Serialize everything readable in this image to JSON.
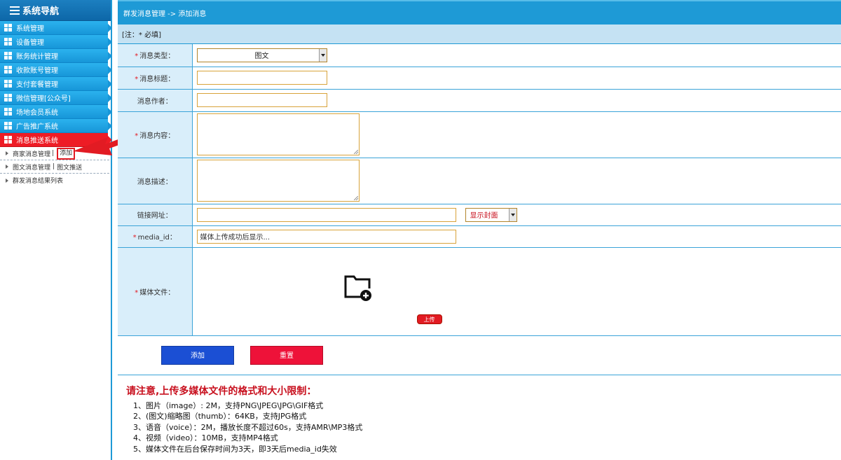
{
  "sidebar": {
    "title": "系统导航",
    "items": [
      {
        "label": "系统管理",
        "active": false
      },
      {
        "label": "设备管理",
        "active": false
      },
      {
        "label": "账务统计管理",
        "active": false
      },
      {
        "label": "收款账号管理",
        "active": false
      },
      {
        "label": "支付套餐管理",
        "active": false
      },
      {
        "label": "微信管理[公众号]",
        "active": false
      },
      {
        "label": "场地会员系统",
        "active": false
      },
      {
        "label": "广告推广系统",
        "active": false
      },
      {
        "label": "消息推送系统",
        "active": true
      }
    ],
    "sub_items": [
      {
        "label": "商家消息管理",
        "sep": "|",
        "extra": "添加"
      },
      {
        "label": "图文消息管理",
        "sep": "|",
        "extra": "图文推送"
      },
      {
        "label": "群发消息结果列表",
        "sep": "",
        "extra": ""
      }
    ]
  },
  "breadcrumb": {
    "text": "群发消息管理 -> 添加消息"
  },
  "note": {
    "text": "[注：* 必填]"
  },
  "form": {
    "required_mark": "*",
    "type_label": "消息类型：",
    "type_value": "图文",
    "title_label": "消息标题：",
    "author_label": "消息作者：",
    "content_label": "消息内容：",
    "desc_label": "消息描述：",
    "link_label": "链接网址：",
    "cover_value": "显示封面",
    "media_id_label": "media_id：",
    "media_id_value": "媒体上传成功后显示...",
    "media_file_label": "媒体文件：",
    "upload_label": "上传",
    "add_label": "添加",
    "reset_label": "重置"
  },
  "notes": {
    "title": "请注意,上传多媒体文件的格式和大小限制：",
    "lines": [
      "1、图片（image）: 2M，支持PNG\\JPEG\\JPG\\GIF格式",
      "2、(图文)缩略图（thumb）：64KB，支持JPG格式",
      "3、语音（voice）：2M，播放长度不超过60s，支持AMR\\MP3格式",
      "4、视频（video）：10MB，支持MP4格式",
      "5、媒体文件在后台保存时间为3天，即3天后media_id失效"
    ]
  },
  "colors": {
    "accent": "#1e9ad6",
    "active": "#ee1c25",
    "add_button": "#1b4fd4",
    "reset_button": "#ee1239"
  }
}
